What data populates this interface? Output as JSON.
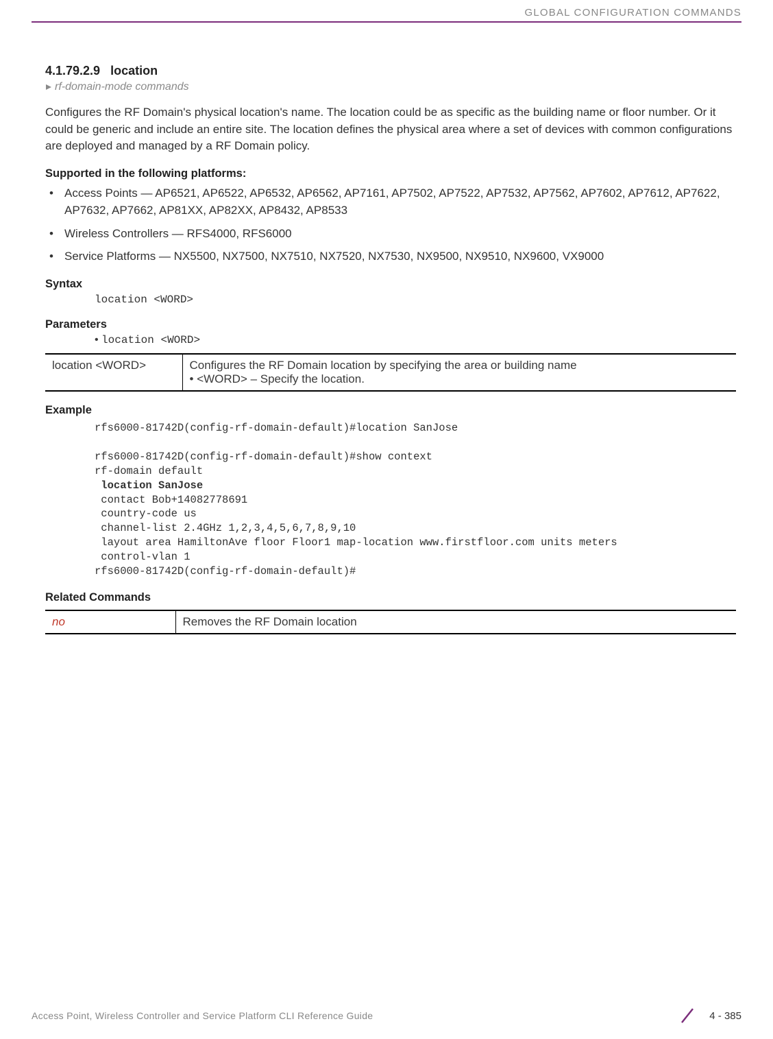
{
  "header": {
    "section": "GLOBAL CONFIGURATION COMMANDS"
  },
  "section": {
    "number": "4.1.79.2.9",
    "title": "location",
    "breadcrumb": "rf-domain-mode commands",
    "intro": "Configures the RF Domain's physical location's name. The location could be as specific as the building name or floor number. Or it could be generic and include an entire site. The location defines the physical area where a set of devices with common configurations are deployed and managed by a RF Domain policy."
  },
  "supported": {
    "heading": "Supported in the following platforms:",
    "items": [
      "Access Points — AP6521, AP6522, AP6532, AP6562, AP7161, AP7502, AP7522, AP7532, AP7562, AP7602, AP7612, AP7622, AP7632, AP7662, AP81XX, AP82XX, AP8432, AP8533",
      "Wireless Controllers — RFS4000, RFS6000",
      "Service Platforms — NX5500, NX7500, NX7510, NX7520, NX7530, NX9500, NX9510, NX9600, VX9000"
    ]
  },
  "syntax": {
    "heading": "Syntax",
    "code": "location <WORD>"
  },
  "parameters": {
    "heading": "Parameters",
    "bullet_code": "location <WORD>",
    "table": {
      "col1": "location <WORD>",
      "col2_line1": "Configures the RF Domain location by specifying the area or building name",
      "col2_bullet": "<WORD> – Specify the location."
    }
  },
  "example": {
    "heading": "Example",
    "lines_pre": "rfs6000-81742D(config-rf-domain-default)#location SanJose\n\nrfs6000-81742D(config-rf-domain-default)#show context\nrf-domain default",
    "bold_line": " location SanJose",
    "lines_post": " contact Bob+14082778691\n country-code us\n channel-list 2.4GHz 1,2,3,4,5,6,7,8,9,10\n layout area HamiltonAve floor Floor1 map-location www.firstfloor.com units meters\n control-vlan 1\nrfs6000-81742D(config-rf-domain-default)#"
  },
  "related": {
    "heading": "Related Commands",
    "table": {
      "col1": "no",
      "col2": "Removes the RF Domain location"
    }
  },
  "footer": {
    "title": "Access Point, Wireless Controller and Service Platform CLI Reference Guide",
    "page": "4 - 385"
  }
}
